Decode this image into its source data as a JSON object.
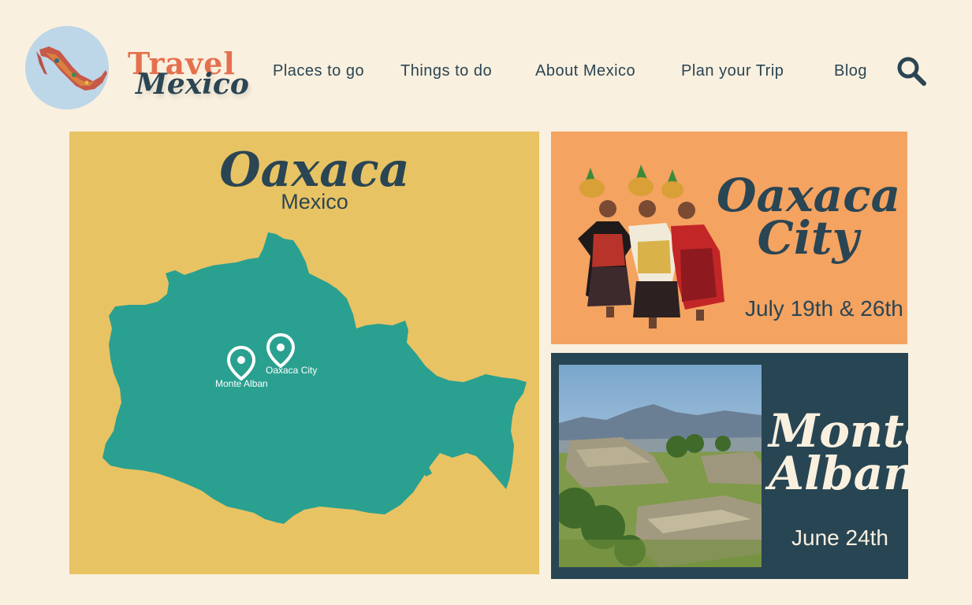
{
  "brand": {
    "line1": "Travel",
    "line2": "Mexico"
  },
  "nav": {
    "places": "Places to go",
    "things": "Things to do",
    "about": "About Mexico",
    "plan": "Plan your Trip",
    "blog": "Blog"
  },
  "icons": {
    "logo": "mexico-map-icon",
    "search": "search-icon",
    "pin": "map-pin-icon"
  },
  "map": {
    "title": "Oaxaca",
    "subtitle": "Mexico",
    "pins": [
      {
        "label": "Monte Alban"
      },
      {
        "label": "Oaxaca City"
      }
    ]
  },
  "cards": [
    {
      "title_line1": "Oaxaca",
      "title_line2": "City",
      "date": "July 19th & 26th"
    },
    {
      "title_line1": "Monte",
      "title_line2": "Alban",
      "date": "June 24th"
    }
  ],
  "colors": {
    "background": "#f9f0df",
    "brand_orange": "#e5704e",
    "navy": "#2a4553",
    "map_panel": "#e8c363",
    "state_teal": "#2aa090",
    "card_orange": "#f4a361",
    "card_cream_text": "#f9f0df"
  }
}
